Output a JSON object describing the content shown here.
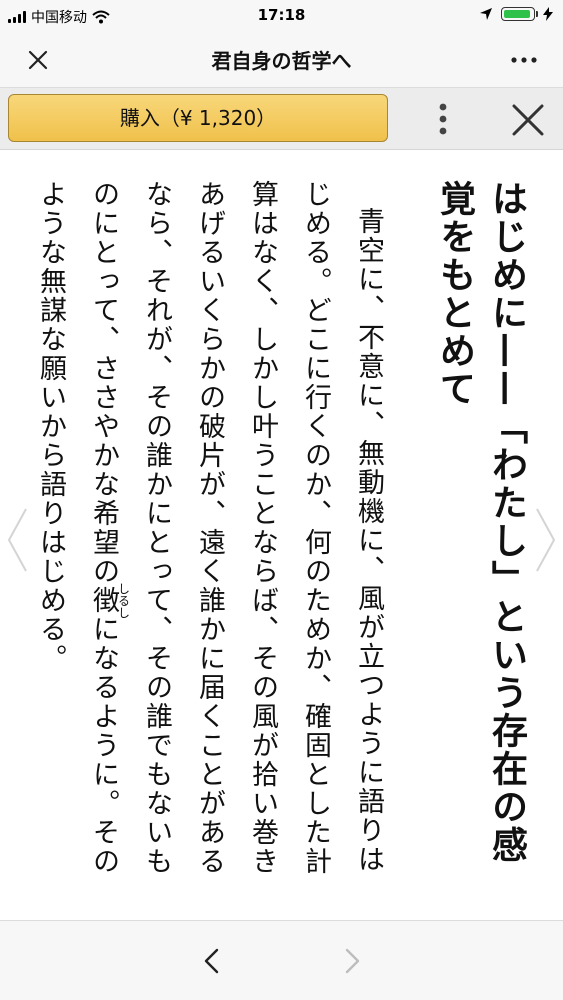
{
  "status_bar": {
    "carrier": "中国移动",
    "time": "17:18",
    "battery_color": "#2ec24a"
  },
  "nav": {
    "title": "君自身の哲学へ",
    "close_icon": "close-icon",
    "more_icon": "more-horizontal-icon"
  },
  "toolbar": {
    "buy_label": "購入（¥ 1,320）",
    "buy_color": "#f0c14b",
    "more_icon": "more-vertical-icon",
    "close_icon": "close-icon"
  },
  "reader": {
    "chapter_title": "はじめに——「わたし」という存在の感覚をもとめて",
    "paragraph_part1": "青空に、不意に、無動機に、風が立つように語りはじめる。どこに行くのか、何のためか、確固とした計算はなく、しかし叶うことならば、その風が拾い巻きあげるいくらかの破片が、遠く誰かに届くことがあるなら、それが、その誰かにとって、その誰でもないものにとって、ささやかな希望の",
    "ruby_base": "徴",
    "ruby_reading": "しるし",
    "paragraph_part2": "になるように。そのような無謀な願いから語りはじめる。"
  },
  "bottom_bar": {
    "back_icon": "chevron-left-icon",
    "forward_icon": "chevron-right-icon"
  }
}
